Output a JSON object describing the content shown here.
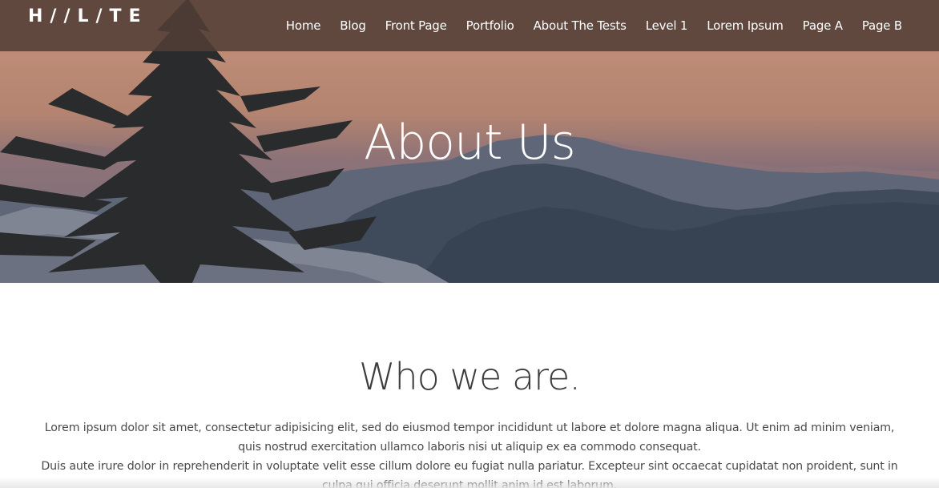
{
  "header": {
    "logo": "H//L/TE",
    "nav": [
      "Home",
      "Blog",
      "Front Page",
      "Portfolio",
      "About The Tests",
      "Level 1",
      "Lorem Ipsum",
      "Page A",
      "Page B"
    ]
  },
  "hero": {
    "title": "About Us"
  },
  "main": {
    "heading": "Who we are.",
    "paragraphs": [
      "Lorem ipsum dolor sit amet, consectetur adipisicing elit, sed do eiusmod tempor incididunt ut labore et dolore magna aliqua. Ut enim ad minim veniam, quis nostrud exercitation ullamco laboris nisi ut aliquip ex ea commodo consequat.",
      "Duis aute irure dolor in reprehenderit in voluptate velit esse cillum dolore eu fugiat nulla pariatur. Excepteur sint occaecat cupidatat non proident, sunt in culpa qui officia deserunt mollit anim id est laborum."
    ]
  },
  "colors": {
    "header_bg": "#523e36",
    "sky_top": "#b58772",
    "mountain_blue": "#4a5767",
    "heading_text": "#3d3d3d",
    "body_text": "#4a4a4a"
  }
}
